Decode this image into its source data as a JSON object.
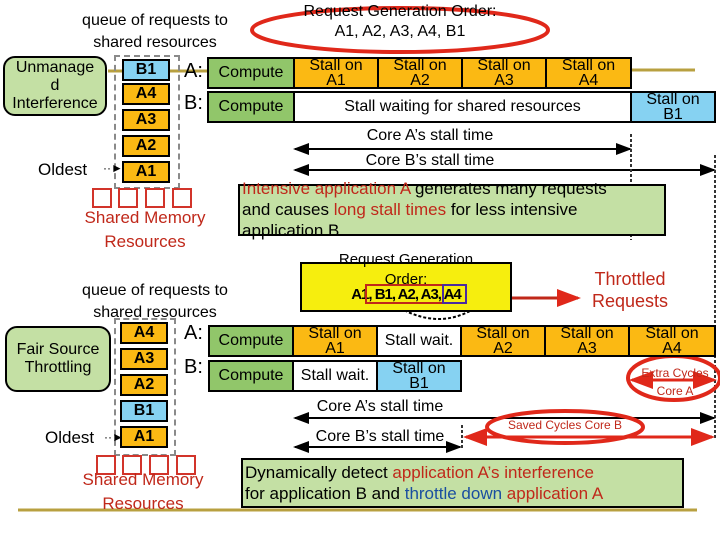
{
  "top": {
    "queue_title": [
      "queue of requests to",
      "shared resources"
    ],
    "policy_label": [
      "Unmanage",
      "d",
      "Interference"
    ],
    "queue": [
      {
        "label": "B1",
        "color": "blue"
      },
      {
        "label": "A4",
        "color": "orange"
      },
      {
        "label": "A3",
        "color": "orange"
      },
      {
        "label": "A2",
        "color": "orange"
      },
      {
        "label": "A1",
        "color": "orange"
      }
    ],
    "oldest_label": "Oldest",
    "memory_label": [
      "Shared Memory",
      "Resources"
    ],
    "order_title": "Request Generation Order:",
    "order_value": "A1, A2, A3, A4, B1",
    "core_a_label": "A:",
    "core_b_label": "B:",
    "core_a_segments": [
      {
        "text": [
          "Compute"
        ],
        "color": "green"
      },
      {
        "text": [
          "Stall on",
          "A1"
        ],
        "color": "orange"
      },
      {
        "text": [
          "Stall on",
          "A2"
        ],
        "color": "orange"
      },
      {
        "text": [
          "Stall on",
          "A3"
        ],
        "color": "orange"
      },
      {
        "text": [
          "Stall on",
          "A4"
        ],
        "color": "orange"
      }
    ],
    "core_b_segments": [
      {
        "text": [
          "Compute"
        ],
        "color": "green"
      },
      {
        "text": [
          "Stall waiting for shared resources"
        ],
        "color": "white"
      },
      {
        "text": [
          "Stall on",
          "B1"
        ],
        "color": "blue"
      }
    ],
    "core_a_stall": "Core A’s stall time",
    "core_b_stall": "Core B’s stall time",
    "note": {
      "line1_red": "Intensive application A",
      "line1_black": " generates many requests",
      "line2_black_a": "and causes ",
      "line2_red": "long stall times",
      "line2_black_b": " for less intensive",
      "line3": "application B"
    }
  },
  "bottom": {
    "queue_title": [
      "queue of requests to",
      "shared resources"
    ],
    "policy_label": [
      "Fair Source",
      "Throttling"
    ],
    "queue": [
      {
        "label": "A4",
        "color": "orange"
      },
      {
        "label": "A3",
        "color": "orange"
      },
      {
        "label": "A2",
        "color": "orange"
      },
      {
        "label": "B1",
        "color": "blue"
      },
      {
        "label": "A1",
        "color": "orange"
      }
    ],
    "oldest_label": "Oldest",
    "memory_label": [
      "Shared Memory",
      "Resources"
    ],
    "order_title": [
      "Request Generation",
      "Order:"
    ],
    "order_value": "A1, B1, A2, A3, A4",
    "order_overlap": "A1, A2, A3, A4, B1",
    "throttled_label": [
      "Throttled",
      "Requests"
    ],
    "core_a_label": "A:",
    "core_b_label": "B:",
    "core_a_segments": [
      {
        "text": [
          "Compute"
        ],
        "color": "green"
      },
      {
        "text": [
          "Stall on",
          "A1"
        ],
        "color": "orange"
      },
      {
        "text": [
          "Stall wait."
        ],
        "color": "white"
      },
      {
        "text": [
          "Stall on",
          "A2"
        ],
        "color": "orange"
      },
      {
        "text": [
          "Stall on",
          "A3"
        ],
        "color": "orange"
      },
      {
        "text": [
          "Stall on",
          "A4"
        ],
        "color": "orange"
      }
    ],
    "core_b_segments": [
      {
        "text": [
          "Compute"
        ],
        "color": "green"
      },
      {
        "text": [
          "Stall wait."
        ],
        "color": "white"
      },
      {
        "text": [
          "Stall on",
          "B1"
        ],
        "color": "blue"
      }
    ],
    "extra_cycles": [
      "Extra Cycles",
      "Core A"
    ],
    "saved_cycles": "Saved Cycles Core B",
    "core_a_stall": "Core A’s stall time",
    "core_b_stall": "Core B’s stall time",
    "note": {
      "line1_black": "Dynamically detect ",
      "line1_red": "application A’s interference",
      "line2_black_a": "for application B and ",
      "line2_blue": "throttle down",
      "line2_black_b": " ",
      "line2_red": "application A"
    }
  },
  "colors": {
    "orange": "#fbb913",
    "blue": "#86d2f2",
    "green": "#91c66a",
    "light_green": "#c4e0a4",
    "yellow": "#f6ee0e",
    "red": "#c0281a",
    "accent_blue": "#1a4ea0",
    "rule_gold": "#b8a040"
  }
}
